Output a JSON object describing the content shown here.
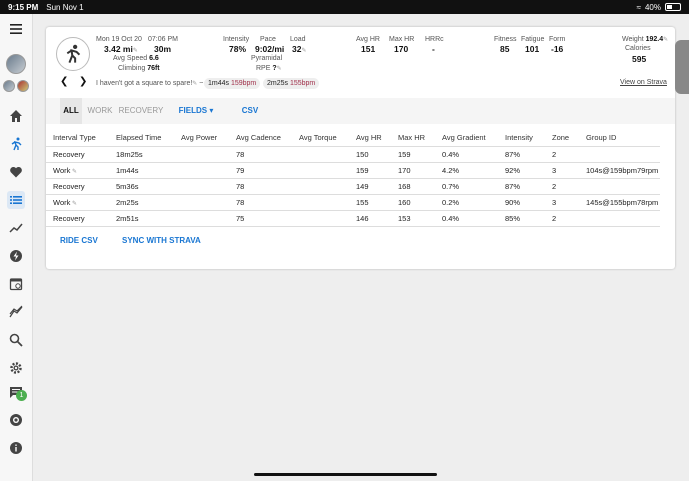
{
  "status": {
    "time": "9:15 PM",
    "date": "Sun Nov 1",
    "battery": "40%"
  },
  "activity": {
    "date": "Mon 19 Oct 20",
    "time": "07:06 PM",
    "distance": "3.42 mi",
    "duration": "30m",
    "avg_speed_label": "Avg Speed",
    "avg_speed": "6.6",
    "climbing_label": "Climbing",
    "climbing": "76ft",
    "intensity_label": "Intensity",
    "intensity": "78%",
    "pace_label": "Pace",
    "pace": "9:02/mi",
    "load_label": "Load",
    "load": "32",
    "workout_name": "Pyramidal",
    "rpe_label": "RPE",
    "rpe": "?",
    "avg_hr_label": "Avg HR",
    "avg_hr": "151",
    "max_hr_label": "Max HR",
    "max_hr": "170",
    "hrrc_label": "HRRc",
    "hrrc": "-",
    "fitness_label": "Fitness",
    "fitness": "85",
    "fatigue_label": "Fatigue",
    "fatigue": "101",
    "form_label": "Form",
    "form": "-16",
    "weight_label": "Weight",
    "weight": "192.4",
    "calories_label": "Calories",
    "calories": "595",
    "note": "I haven't got a square to spare!",
    "note_sep": "~",
    "chip1_time": "1m44s",
    "chip1_hr": "159bpm",
    "chip2_time": "2m25s",
    "chip2_hr": "155bpm",
    "strava_link": "View on Strava"
  },
  "tabs": {
    "all": "ALL",
    "work": "WORK",
    "recovery": "RECOVERY",
    "fields": "FIELDS",
    "csv": "CSV"
  },
  "table": {
    "headers": [
      "Interval Type",
      "Elapsed Time",
      "Avg Power",
      "Avg Cadence",
      "Avg Torque",
      "Avg HR",
      "Max HR",
      "Avg Gradient",
      "Intensity",
      "Zone",
      "Group ID"
    ],
    "rows": [
      [
        "Recovery",
        "18m25s",
        "",
        "78",
        "",
        "150",
        "159",
        "0.4%",
        "87%",
        "2",
        ""
      ],
      [
        "Work",
        "1m44s",
        "",
        "79",
        "",
        "159",
        "170",
        "4.2%",
        "92%",
        "3",
        "104s@159bpm79rpm"
      ],
      [
        "Recovery",
        "5m36s",
        "",
        "78",
        "",
        "149",
        "168",
        "0.7%",
        "87%",
        "2",
        ""
      ],
      [
        "Work",
        "2m25s",
        "",
        "78",
        "",
        "155",
        "160",
        "0.2%",
        "90%",
        "3",
        "145s@155bpm78rpm"
      ],
      [
        "Recovery",
        "2m51s",
        "",
        "75",
        "",
        "146",
        "153",
        "0.4%",
        "85%",
        "2",
        ""
      ]
    ]
  },
  "actions": {
    "ride_csv": "RIDE CSV",
    "sync_strava": "SYNC WITH STRAVA"
  },
  "sidebar": {
    "notification_count": "1"
  },
  "colors": {
    "accent": "#1976d2",
    "hr_chip": "#a0304a",
    "badge": "#4caf50"
  }
}
